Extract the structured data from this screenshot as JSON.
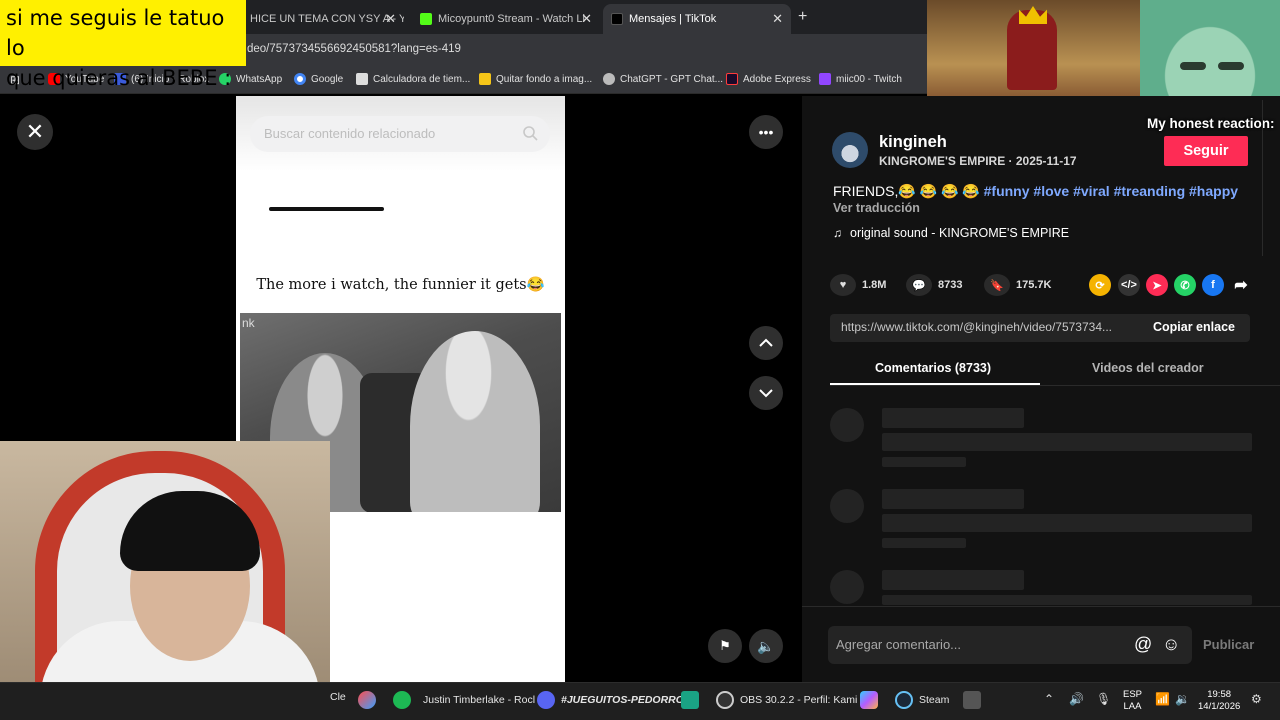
{
  "overlay_text": [
    "si me seguis le tatuo lo",
    "que quieras al BEBE : )"
  ],
  "browser": {
    "tabs": [
      {
        "label": "HICE UN TEMA CON YSY A - Yo",
        "active": false
      },
      {
        "label": "Micoypunt0 Stream - Watch Li",
        "active": false
      },
      {
        "label": "Mensajes | TikTok",
        "active": true
      }
    ],
    "new_tab": "+",
    "url": "deo/7573734556692450581?lang=es-419",
    "bookmarks": [
      "YouTube",
      "(6) Inicio - Roblox",
      "WhatsApp",
      "Google",
      "Calculadora de tiem...",
      "Quitar fondo a imag...",
      "ChatGPT - GPT Chat...",
      "Adobe Express",
      "miic00 - Twitch"
    ]
  },
  "video": {
    "search_placeholder": "Buscar contenido relacionado",
    "caption": "The more i watch, the funnier it gets😂",
    "watermark": "nk"
  },
  "streamer_overlay": {
    "reaction_text": "My honest reaction:"
  },
  "post": {
    "username": "kingineh",
    "subtitle": "KINGROME'S EMPIRE · 2025-11-17",
    "follow_label": "Seguir",
    "description_text": "FRIENDS,😂 😂 😂 😂",
    "hashtags": "#funny #love #viral #treanding #happy",
    "translate": "Ver traducción",
    "sound": "original sound - KINGROME'S EMPIRE",
    "likes": "1.8M",
    "comments": "8733",
    "saves": "175.7K",
    "link": "https://www.tiktok.com/@kingineh/video/7573734...",
    "copy_label": "Copiar enlace",
    "tab_comments": "Comentarios (8733)",
    "tab_videos": "Videos del creador",
    "comment_placeholder": "Agregar comentario...",
    "publish_label": "Publicar"
  },
  "taskbar": {
    "items": [
      "Cle",
      "Justin Timberlake - Rocl",
      "#JUEGUITOS-PEDORRO",
      "OBS 30.2.2 - Perfil: Kami",
      "Steam"
    ],
    "lang": [
      "ESP",
      "LAA"
    ],
    "time": "19:58",
    "date": "14/1/2026"
  },
  "colors": {
    "accent": "#fe2c55",
    "hashtag": "#7fa9ff",
    "panel": "#121212"
  }
}
